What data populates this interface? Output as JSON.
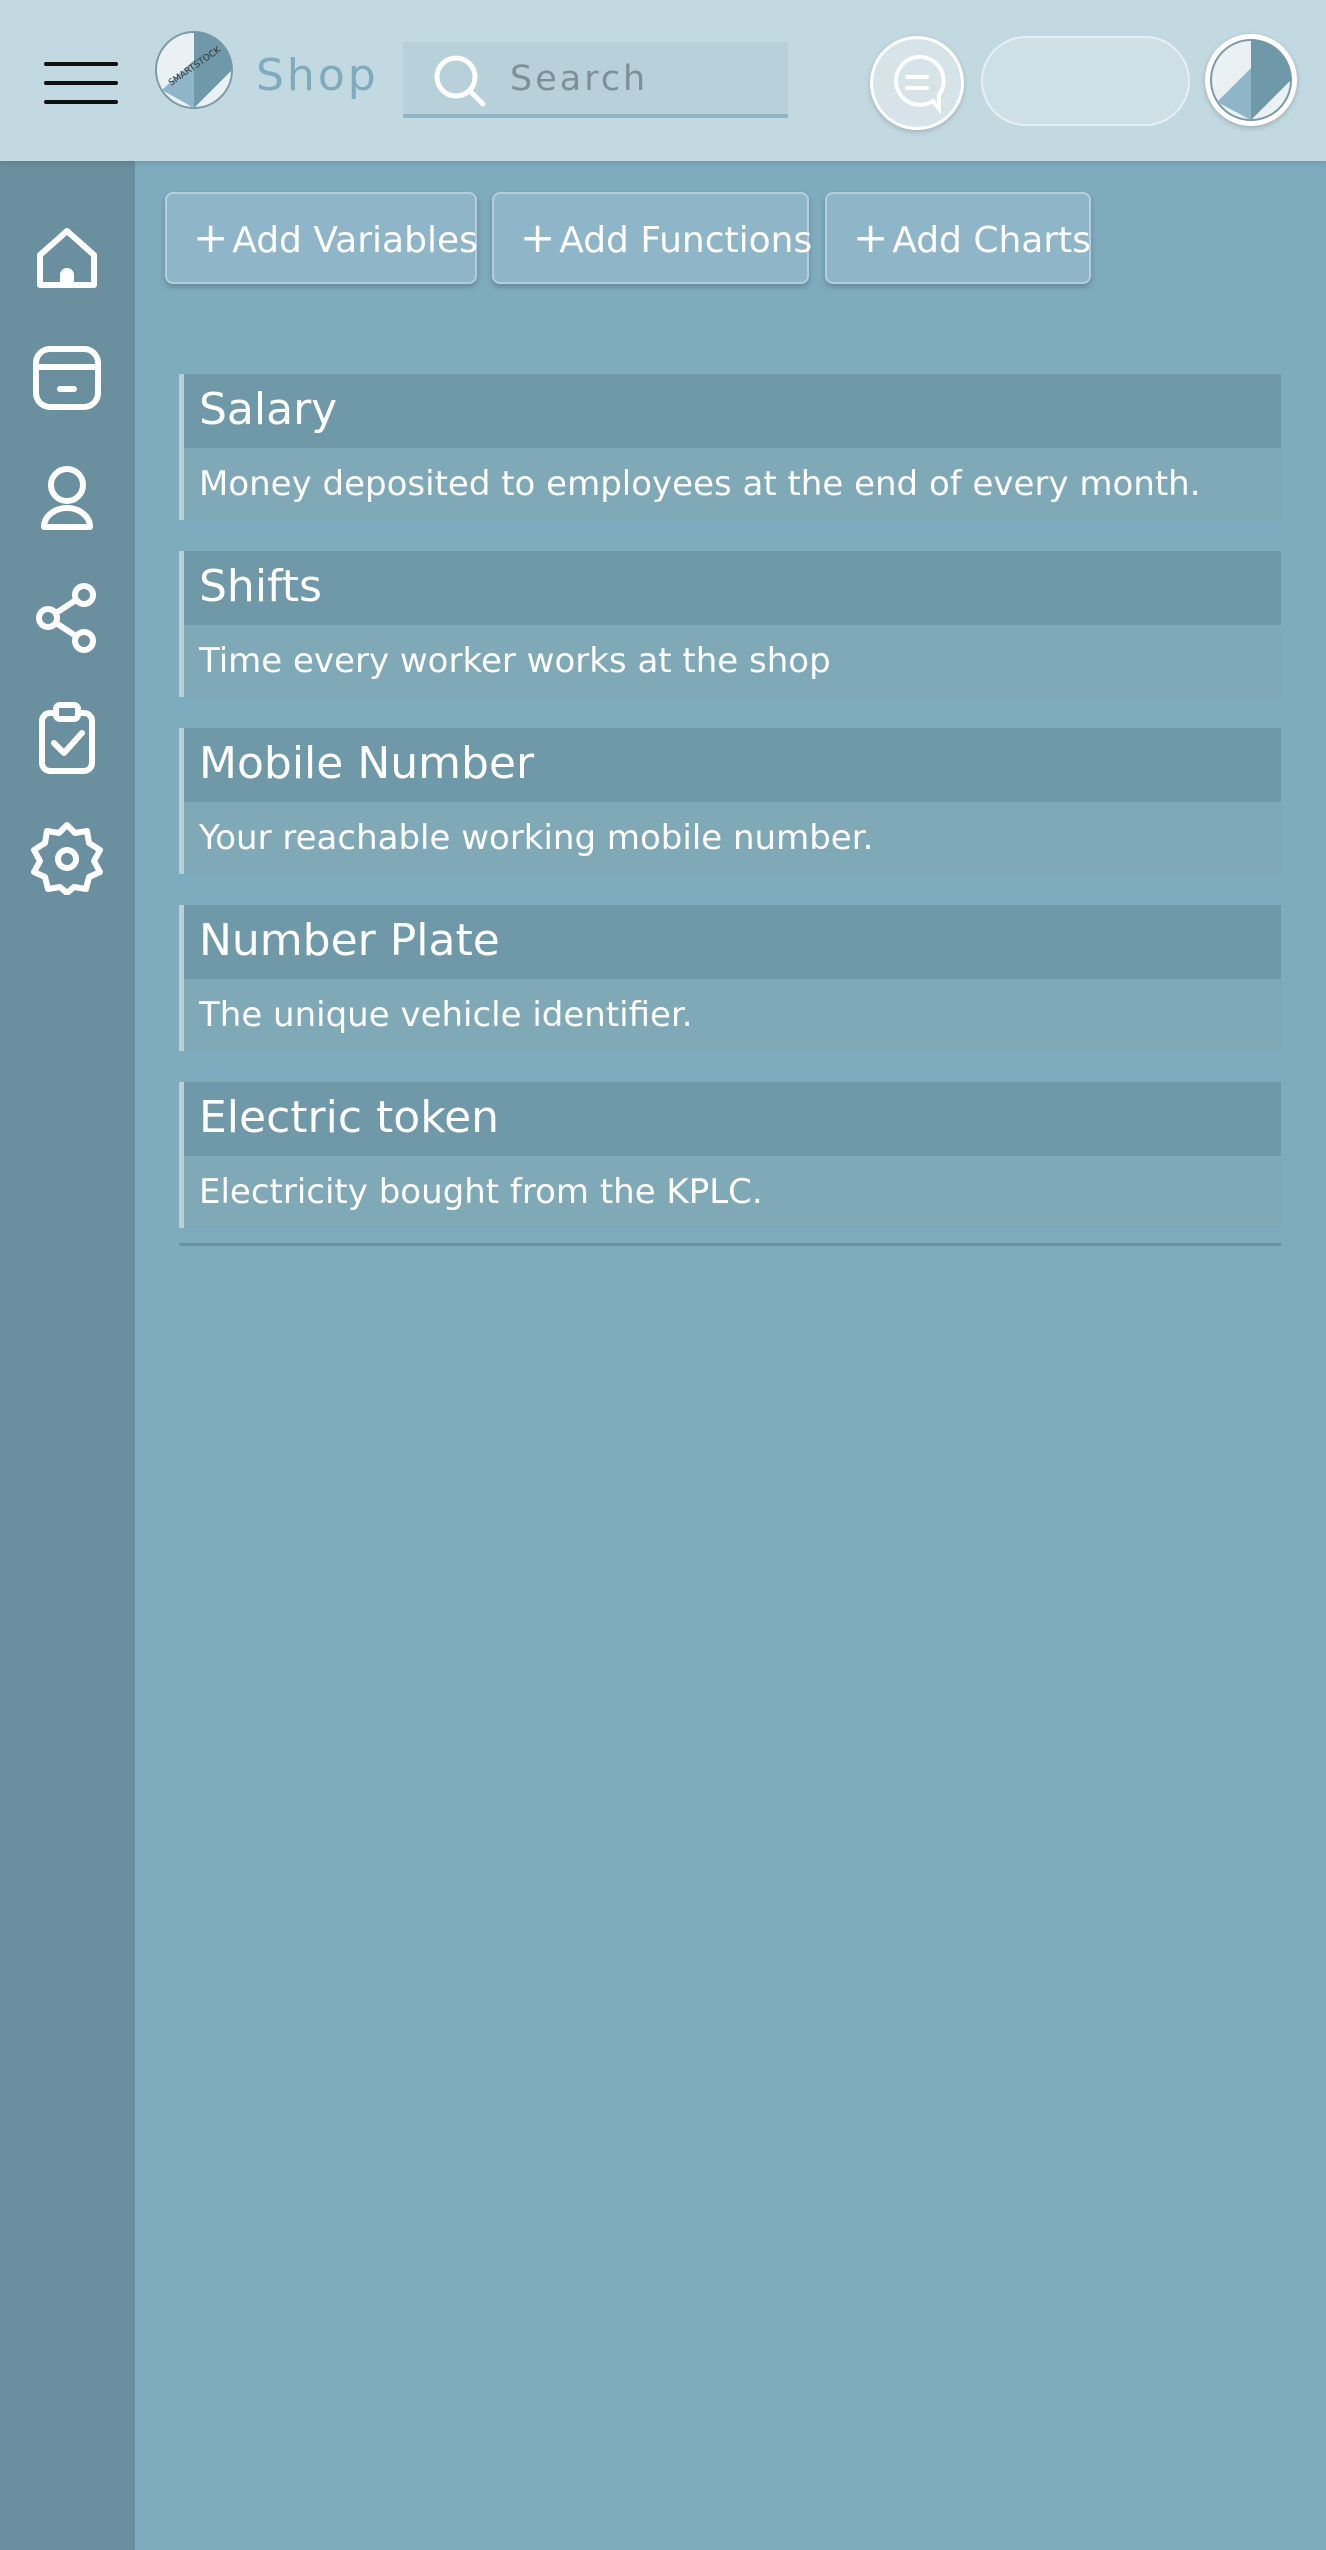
{
  "header": {
    "brand": "Shop",
    "logo_text": "SMARTSTOCK",
    "search": {
      "placeholder": "Search",
      "value": ""
    }
  },
  "sidebar": {
    "items": [
      {
        "name": "home",
        "icon": "home-icon"
      },
      {
        "name": "wallet",
        "icon": "wallet-icon"
      },
      {
        "name": "profile",
        "icon": "user-icon"
      },
      {
        "name": "share",
        "icon": "share-icon"
      },
      {
        "name": "tasks",
        "icon": "clipboard-check-icon"
      },
      {
        "name": "settings",
        "icon": "gear-icon"
      }
    ]
  },
  "toolbar": {
    "add_variables": "Add Variables",
    "add_functions": "Add Functions",
    "add_charts": "Add Charts",
    "plus": "+"
  },
  "variables": [
    {
      "title": "Salary",
      "description": "Money deposited to employees at the end of every month."
    },
    {
      "title": "Shifts",
      "description": "Time every worker works at the shop"
    },
    {
      "title": "Mobile Number",
      "description": "Your reachable working mobile number."
    },
    {
      "title": "Number Plate",
      "description": "The unique vehicle identifier."
    },
    {
      "title": "Electric token",
      "description": "Electricity bought from the KPLC."
    }
  ],
  "colors": {
    "topbar": "#c3d9e1",
    "sidebar": "#6a8f9f",
    "main": "#7fabbe",
    "item_title": "#6f98a8",
    "item_desc": "#80a9b8"
  }
}
